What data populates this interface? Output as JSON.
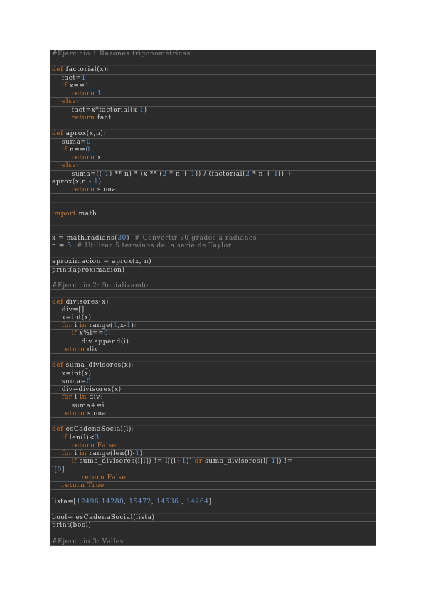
{
  "code_lines": [
    [
      {
        "t": "#Ejercicio 1 Razones trigonométricas",
        "c": "cm"
      }
    ],
    [],
    [
      {
        "t": "def",
        "c": "kw"
      },
      {
        "t": " factorial(x)",
        "c": "pl"
      },
      {
        "t": ":",
        "c": "cl"
      }
    ],
    [
      {
        "t": "    fact=",
        "c": "pl"
      },
      {
        "t": "1",
        "c": "nm"
      }
    ],
    [
      {
        "t": "    ",
        "c": "pl"
      },
      {
        "t": "if",
        "c": "kw"
      },
      {
        "t": " x==",
        "c": "pl"
      },
      {
        "t": "1",
        "c": "nm"
      },
      {
        "t": ":",
        "c": "cl"
      }
    ],
    [
      {
        "t": "        ",
        "c": "pl"
      },
      {
        "t": "return",
        "c": "kw"
      },
      {
        "t": " ",
        "c": "pl"
      },
      {
        "t": "1",
        "c": "nm"
      }
    ],
    [
      {
        "t": "    ",
        "c": "pl"
      },
      {
        "t": "else",
        "c": "kw"
      },
      {
        "t": ":",
        "c": "cl"
      }
    ],
    [
      {
        "t": "        fact=x*factorial(x-",
        "c": "pl"
      },
      {
        "t": "1",
        "c": "nm"
      },
      {
        "t": ")",
        "c": "pl"
      }
    ],
    [
      {
        "t": "        ",
        "c": "pl"
      },
      {
        "t": "return",
        "c": "kw"
      },
      {
        "t": " fact",
        "c": "pl"
      }
    ],
    [],
    [
      {
        "t": "def",
        "c": "kw"
      },
      {
        "t": " aprox(x,n)",
        "c": "pl"
      },
      {
        "t": ":",
        "c": "cl"
      }
    ],
    [
      {
        "t": "    suma=",
        "c": "pl"
      },
      {
        "t": "0",
        "c": "nm"
      }
    ],
    [
      {
        "t": "    ",
        "c": "pl"
      },
      {
        "t": "if",
        "c": "kw"
      },
      {
        "t": " n==",
        "c": "pl"
      },
      {
        "t": "0",
        "c": "nm"
      },
      {
        "t": ":",
        "c": "cl"
      }
    ],
    [
      {
        "t": "        ",
        "c": "pl"
      },
      {
        "t": "return",
        "c": "kw"
      },
      {
        "t": " x",
        "c": "pl"
      }
    ],
    [
      {
        "t": "    ",
        "c": "pl"
      },
      {
        "t": "else",
        "c": "kw"
      },
      {
        "t": ":",
        "c": "cl"
      }
    ],
    [
      {
        "t": "        suma=((-",
        "c": "pl"
      },
      {
        "t": "1",
        "c": "nm"
      },
      {
        "t": ") ** n) * (x ** (",
        "c": "pl"
      },
      {
        "t": "2",
        "c": "nm"
      },
      {
        "t": " * n + ",
        "c": "pl"
      },
      {
        "t": "1",
        "c": "nm"
      },
      {
        "t": ")) / (factorial(",
        "c": "pl"
      },
      {
        "t": "2",
        "c": "nm"
      },
      {
        "t": " * n + ",
        "c": "pl"
      },
      {
        "t": "1",
        "c": "nm"
      },
      {
        "t": ")) +",
        "c": "pl"
      }
    ],
    [
      {
        "t": "aprox(x,n - ",
        "c": "pl"
      },
      {
        "t": "1",
        "c": "nm"
      },
      {
        "t": ")",
        "c": "pl"
      }
    ],
    [
      {
        "t": "        ",
        "c": "pl"
      },
      {
        "t": "return",
        "c": "kw"
      },
      {
        "t": " suma",
        "c": "pl"
      }
    ],
    [],
    [],
    [
      {
        "t": "import",
        "c": "kw"
      },
      {
        "t": " math",
        "c": "pl"
      }
    ],
    [],
    [],
    [
      {
        "t": "x = math.radians(",
        "c": "pl"
      },
      {
        "t": "30",
        "c": "nm"
      },
      {
        "t": ")  ",
        "c": "pl"
      },
      {
        "t": "# Convertir 30 grados a radianes",
        "c": "cm"
      }
    ],
    [
      {
        "t": "n = ",
        "c": "pl"
      },
      {
        "t": "5",
        "c": "nm"
      },
      {
        "t": "  ",
        "c": "pl"
      },
      {
        "t": "# Utilizar 5 términos de la serie de Taylor",
        "c": "cm"
      }
    ],
    [],
    [
      {
        "t": "aproximacion = aprox(x, n)",
        "c": "pl"
      }
    ],
    [
      {
        "t": "print(aproximacion)",
        "c": "pl"
      }
    ],
    [],
    [
      {
        "t": "#Ejercicio 2: Socializando",
        "c": "cm"
      }
    ],
    [],
    [
      {
        "t": "def",
        "c": "kw"
      },
      {
        "t": " divisores(x)",
        "c": "pl"
      },
      {
        "t": ":",
        "c": "cl"
      }
    ],
    [
      {
        "t": "    div=[]",
        "c": "pl"
      }
    ],
    [
      {
        "t": "    x=int(x)",
        "c": "pl"
      }
    ],
    [
      {
        "t": "    ",
        "c": "pl"
      },
      {
        "t": "for",
        "c": "kw"
      },
      {
        "t": " i ",
        "c": "pl"
      },
      {
        "t": "in",
        "c": "kw"
      },
      {
        "t": " range(",
        "c": "pl"
      },
      {
        "t": "1",
        "c": "nm"
      },
      {
        "t": ",x-",
        "c": "pl"
      },
      {
        "t": "1",
        "c": "nm"
      },
      {
        "t": ")",
        "c": "pl"
      },
      {
        "t": ":",
        "c": "cl"
      }
    ],
    [
      {
        "t": "        ",
        "c": "pl"
      },
      {
        "t": "if",
        "c": "kw"
      },
      {
        "t": " x%i==",
        "c": "pl"
      },
      {
        "t": "0",
        "c": "nm"
      },
      {
        "t": ":",
        "c": "cl"
      }
    ],
    [
      {
        "t": "            div.append(i)",
        "c": "pl"
      }
    ],
    [
      {
        "t": "    ",
        "c": "pl"
      },
      {
        "t": "return",
        "c": "kw"
      },
      {
        "t": " div",
        "c": "pl"
      }
    ],
    [],
    [
      {
        "t": "def",
        "c": "kw"
      },
      {
        "t": " suma_divisores(x)",
        "c": "pl"
      },
      {
        "t": ":",
        "c": "cl"
      }
    ],
    [
      {
        "t": "    x=int(x)",
        "c": "pl"
      }
    ],
    [
      {
        "t": "    suma=",
        "c": "pl"
      },
      {
        "t": "0",
        "c": "nm"
      }
    ],
    [
      {
        "t": "    div=divisores(x)",
        "c": "pl"
      }
    ],
    [
      {
        "t": "    ",
        "c": "pl"
      },
      {
        "t": "for",
        "c": "kw"
      },
      {
        "t": " i ",
        "c": "pl"
      },
      {
        "t": "in",
        "c": "kw"
      },
      {
        "t": " div",
        "c": "pl"
      },
      {
        "t": ":",
        "c": "cl"
      }
    ],
    [
      {
        "t": "        suma+=i",
        "c": "pl"
      }
    ],
    [
      {
        "t": "    ",
        "c": "pl"
      },
      {
        "t": "return",
        "c": "kw"
      },
      {
        "t": " suma",
        "c": "pl"
      }
    ],
    [],
    [
      {
        "t": "def",
        "c": "kw"
      },
      {
        "t": " esCadenaSocial(l)",
        "c": "pl"
      },
      {
        "t": ":",
        "c": "cl"
      }
    ],
    [
      {
        "t": "    ",
        "c": "pl"
      },
      {
        "t": "if",
        "c": "kw"
      },
      {
        "t": " len(l)<",
        "c": "pl"
      },
      {
        "t": "3",
        "c": "nm"
      },
      {
        "t": ":",
        "c": "cl"
      }
    ],
    [
      {
        "t": "        ",
        "c": "pl"
      },
      {
        "t": "return",
        "c": "kw"
      },
      {
        "t": " ",
        "c": "pl"
      },
      {
        "t": "False",
        "c": "kw"
      }
    ],
    [
      {
        "t": "    ",
        "c": "pl"
      },
      {
        "t": "for",
        "c": "kw"
      },
      {
        "t": " i ",
        "c": "pl"
      },
      {
        "t": "in",
        "c": "kw"
      },
      {
        "t": " range(len(l)-",
        "c": "pl"
      },
      {
        "t": "1",
        "c": "nm"
      },
      {
        "t": ")",
        "c": "pl"
      },
      {
        "t": ":",
        "c": "cl"
      }
    ],
    [
      {
        "t": "        ",
        "c": "pl"
      },
      {
        "t": "if",
        "c": "kw"
      },
      {
        "t": " suma_divisores(l[i]) != l[(i+",
        "c": "pl"
      },
      {
        "t": "1",
        "c": "nm"
      },
      {
        "t": ")] ",
        "c": "pl"
      },
      {
        "t": "or",
        "c": "kw"
      },
      {
        "t": " suma_divisores(l[-",
        "c": "pl"
      },
      {
        "t": "1",
        "c": "nm"
      },
      {
        "t": "]) !=",
        "c": "pl"
      }
    ],
    [
      {
        "t": "l[",
        "c": "pl"
      },
      {
        "t": "0",
        "c": "nm"
      },
      {
        "t": "]",
        "c": "pl"
      },
      {
        "t": ":",
        "c": "cl"
      }
    ],
    [
      {
        "t": "            ",
        "c": "pl"
      },
      {
        "t": "return",
        "c": "kw"
      },
      {
        "t": " ",
        "c": "pl"
      },
      {
        "t": "False",
        "c": "kw"
      }
    ],
    [
      {
        "t": "    ",
        "c": "pl"
      },
      {
        "t": "return",
        "c": "kw"
      },
      {
        "t": " ",
        "c": "pl"
      },
      {
        "t": "True",
        "c": "kw"
      }
    ],
    [],
    [
      {
        "t": "lista=[",
        "c": "pl"
      },
      {
        "t": "12496",
        "c": "nm"
      },
      {
        "t": ",",
        "c": "pl"
      },
      {
        "t": "14288",
        "c": "nm"
      },
      {
        "t": ", ",
        "c": "pl"
      },
      {
        "t": "15472",
        "c": "nm"
      },
      {
        "t": ", ",
        "c": "pl"
      },
      {
        "t": "14536",
        "c": "nm"
      },
      {
        "t": " , ",
        "c": "pl"
      },
      {
        "t": "14264",
        "c": "nm"
      },
      {
        "t": "]",
        "c": "pl"
      }
    ],
    [],
    [
      {
        "t": "bool= esCadenaSocial(lista)",
        "c": "pl"
      }
    ],
    [
      {
        "t": "print(bool)",
        "c": "pl"
      }
    ],
    [],
    [
      {
        "t": "#Ejercicio 3: Valles",
        "c": "cm"
      }
    ]
  ],
  "colors": {
    "background": "#2b2b2b",
    "keyword": "#cc7832",
    "comment": "#8a8a8a",
    "number": "#6b9bd1",
    "text": "#d6d6d6"
  }
}
